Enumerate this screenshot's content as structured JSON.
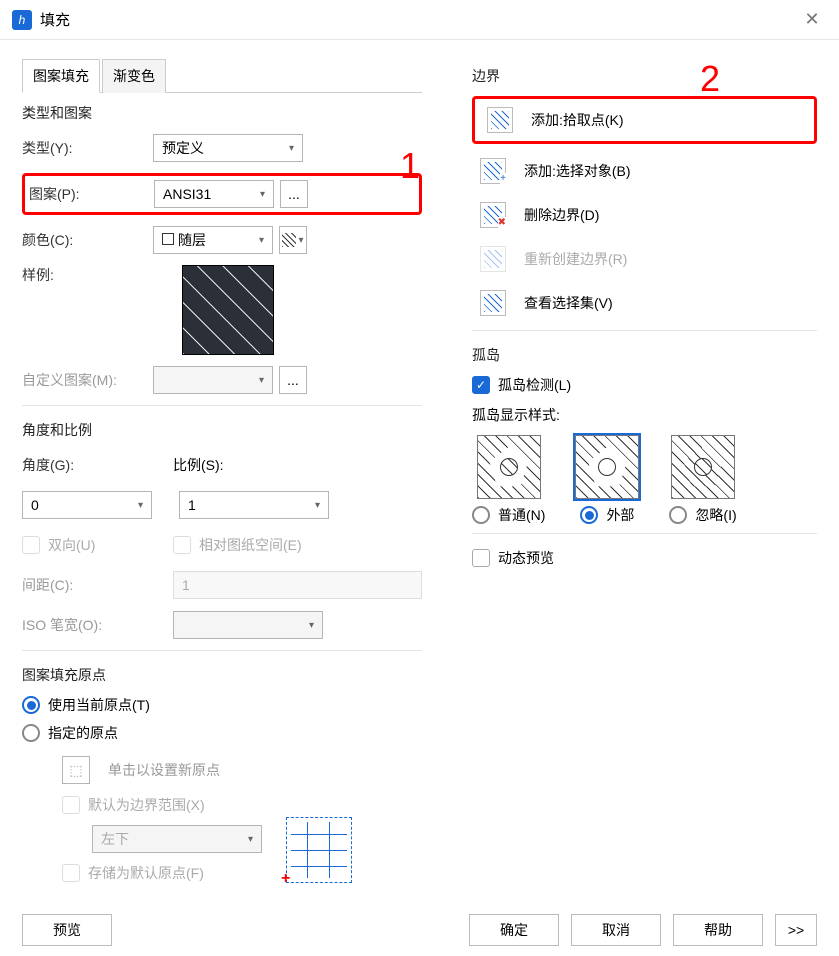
{
  "title": "填充",
  "tabs": {
    "fill": "图案填充",
    "gradient": "渐变色"
  },
  "left": {
    "sec_type": "类型和图案",
    "type_lbl": "类型(Y):",
    "type_val": "预定义",
    "pattern_lbl": "图案(P):",
    "pattern_val": "ANSI31",
    "ellipsis": "...",
    "color_lbl": "颜色(C):",
    "color_val": "随层",
    "sample_lbl": "样例:",
    "custom_lbl": "自定义图案(M):",
    "sec_angle": "角度和比例",
    "angle_lbl": "角度(G):",
    "angle_val": "0",
    "scale_lbl": "比例(S):",
    "scale_val": "1",
    "bidir": "双向(U)",
    "relpaper": "相对图纸空间(E)",
    "spacing_lbl": "间距(C):",
    "spacing_val": "1",
    "iso_lbl": "ISO 笔宽(O):",
    "sec_origin": "图案填充原点",
    "use_cur": "使用当前原点(T)",
    "spec_origin": "指定的原点",
    "click_set": "单击以设置新原点",
    "default_ext": "默认为边界范围(X)",
    "bl": "左下",
    "store_def": "存储为默认原点(F)"
  },
  "right": {
    "sec_boundary": "边界",
    "pick": "添加:拾取点(K)",
    "sel_obj": "添加:选择对象(B)",
    "del": "删除边界(D)",
    "recreate": "重新创建边界(R)",
    "view_sel": "查看选择集(V)",
    "sec_island": "孤岛",
    "island_detect": "孤岛检测(L)",
    "island_style": "孤岛显示样式:",
    "island_normal": "普通(N)",
    "island_outer": "外部",
    "island_ignore": "忽略(I)",
    "dyn_preview": "动态预览"
  },
  "footer": {
    "preview": "预览",
    "ok": "确定",
    "cancel": "取消",
    "help": "帮助",
    "expand": ">>"
  },
  "annot": {
    "n1": "1",
    "n2": "2"
  }
}
